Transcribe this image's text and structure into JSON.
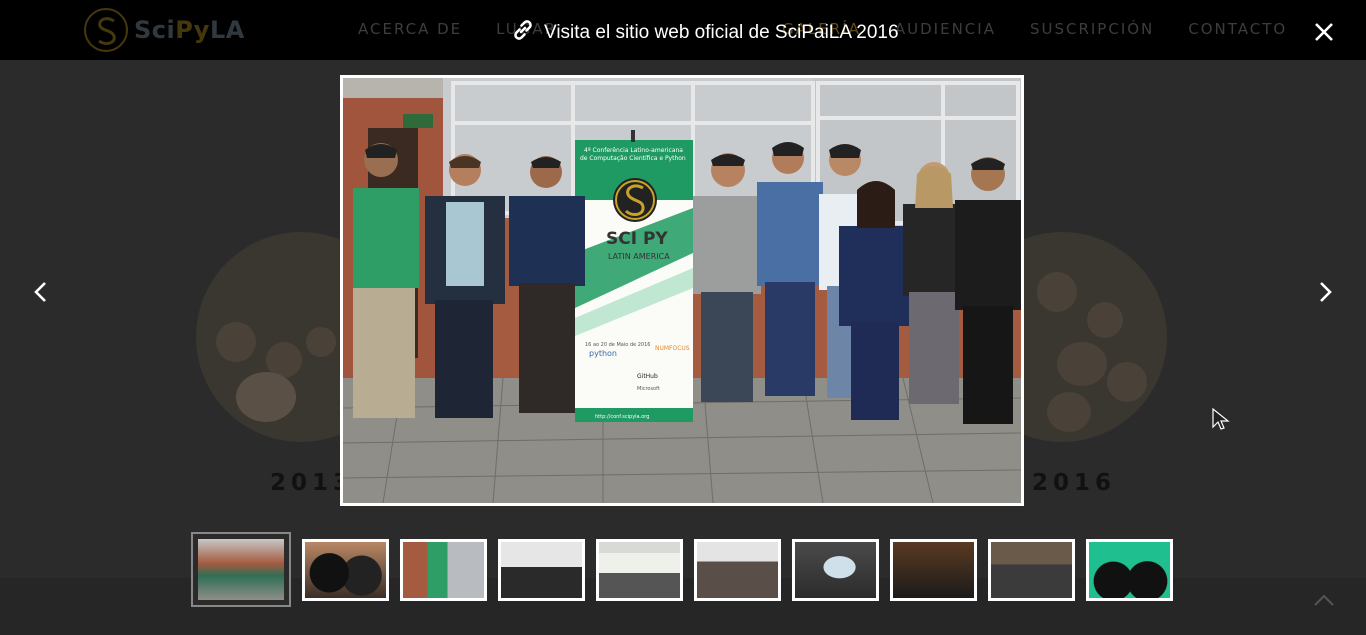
{
  "site": {
    "logo_text_a": "Sci",
    "logo_text_b": "Py",
    "logo_text_c": "LA",
    "nav": [
      {
        "label": "ACERCA DE"
      },
      {
        "label": "LUGAR"
      },
      {
        "label": "GALERÍA",
        "active": true
      },
      {
        "label": "AUDIENCIA"
      },
      {
        "label": "SUSCRIPCIÓN"
      },
      {
        "label": "CONTACTO"
      }
    ],
    "years": {
      "left": "2013",
      "right": "2016"
    }
  },
  "lightbox": {
    "title": "Visita el sitio web oficial de SciPaiLA 2016",
    "banner": {
      "line1": "4ª Conferência Latino-americana",
      "line2": "de Computação Científica e Python",
      "brand": "SCI PY",
      "sub": "LATIN AMERICA",
      "dates": "16 ao 20 de Maio de 2016",
      "sponsor1": "python",
      "sponsor2": "NUMFOCUS",
      "sponsor3": "GitHub",
      "sponsor4": "Microsoft",
      "url": "http://conf.scipyla.org"
    },
    "thumbnail_count": 10,
    "selected_index": 0
  },
  "colors": {
    "brand_gold": "#c9a227",
    "banner_green": "#1f9a62",
    "overlay": "#2b2b2b"
  },
  "icons": {
    "title": "link-icon",
    "close": "close-icon",
    "prev": "chevron-left-icon",
    "next": "chevron-right-icon",
    "back_top": "chevron-up-icon"
  }
}
